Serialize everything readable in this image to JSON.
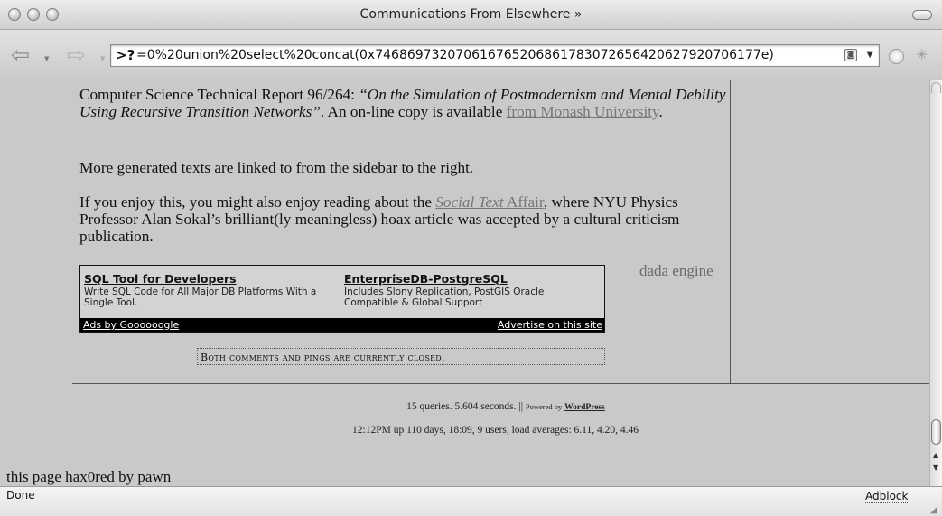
{
  "window": {
    "title": "Communications From Elsewhere »"
  },
  "toolbar": {
    "url": "=0%20union%20select%20concat(0x746869732070616765206861783072656420627920706177e)"
  },
  "article": {
    "p1_lead": "Computer Science Technical Report 96/264: ",
    "p1_title": "“On the Simulation of Postmodernism and Mental Debility Using Recursive Transition Networks”",
    "p1_mid": ". An on-line copy is available ",
    "p1_link": "from Monash University",
    "p1_end": ".",
    "p2": "More generated texts are linked to from the sidebar to the right.",
    "p3_lead": "If you enjoy this, you might also enjoy reading about the ",
    "p3_link_italic": "Social Text",
    "p3_link_rest": " Affair",
    "p3_end": ", where NYU Physics Professor Alan Sokal’s brilliant(ly meaningless) hoax article was accepted by a cultural criticism publication."
  },
  "ads": {
    "items": [
      {
        "title": "SQL Tool for Developers",
        "desc": "Write SQL Code for All Major DB Platforms With a Single Tool."
      },
      {
        "title": "EnterpriseDB-PostgreSQL",
        "desc": "Includes Slony Replication, PostGIS Oracle Compatible & Global Support"
      }
    ],
    "ads_by": "Ads by Goooooogle",
    "advertise": "Advertise on this site"
  },
  "sidebar": {
    "dada": "dada engine"
  },
  "comments": {
    "closed": "Both comments and pings are currently closed."
  },
  "footer": {
    "stats": "15 queries. 5.604 seconds. ||",
    "powered": "Powered by",
    "wordpress": "WordPress",
    "uptime": "12:12PM up 110 days, 18:09, 9 users, load averages: 6.11, 4.20, 4.46"
  },
  "injected": "this page hax0red by pawn",
  "status": {
    "text": "Done",
    "adblock": "Adblock"
  }
}
